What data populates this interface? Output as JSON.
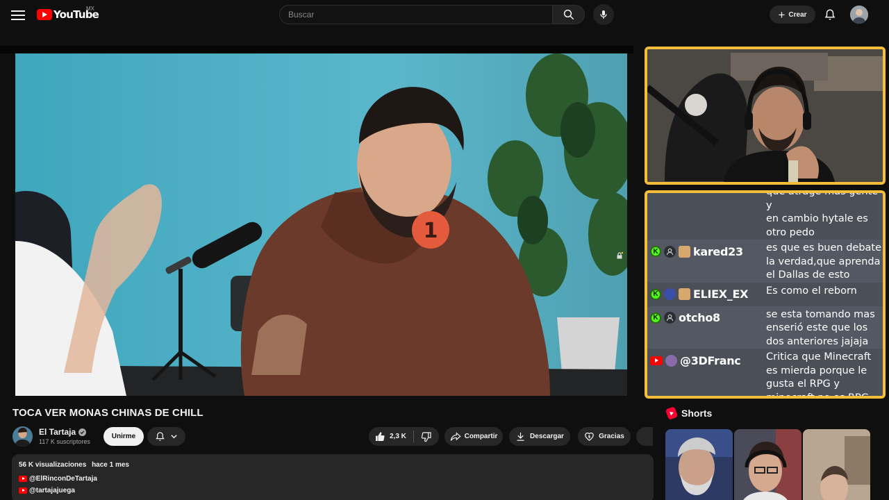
{
  "header": {
    "logo_text": "YouTube",
    "region": "MX",
    "search_placeholder": "Buscar",
    "create_label": "Crear"
  },
  "stream_chat": {
    "partial_top": "que atrage mas gente y",
    "messages": [
      {
        "platform": "none",
        "user": "",
        "text": "en cambio hytale es otro pedo"
      },
      {
        "platform": "kick",
        "user": "kared23",
        "text": "es que es buen debate la verdad,que aprenda el Dallas de esto"
      },
      {
        "platform": "kick",
        "user": "ELIEX_EX",
        "text": "Es como el reborn"
      },
      {
        "platform": "kick",
        "user": "otcho8",
        "text": "se esta tomando mas enserió este que los dos anteriores jajaja"
      },
      {
        "platform": "youtube",
        "user": "@3DFranc",
        "text": "Critica que Minecraft es mierda porque le gusta el RPG y minecraft no es RPG"
      }
    ]
  },
  "video": {
    "title": "TOCA VER MONAS CHINAS DE CHILL",
    "channel": "El Tartaja",
    "subscribers": "117 K suscriptores",
    "join_label": "Unirme",
    "likes": "2,3 K",
    "share_label": "Compartir",
    "download_label": "Descargar",
    "thanks_label": "Gracias",
    "views": "56 K visualizaciones",
    "published": "hace 1 mes",
    "desc_links": [
      "@ElRinconDeTartaja",
      "@tartajajuega"
    ]
  },
  "shorts": {
    "heading": "Shorts"
  },
  "colors": {
    "background": "#0f0f0f",
    "overlay_border": "#f4be3a",
    "youtube_red": "#ff0000",
    "kick_green": "#53fc18"
  }
}
